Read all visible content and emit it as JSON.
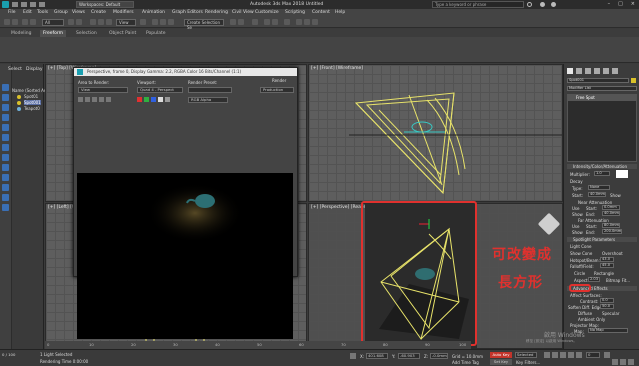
{
  "titlebar": {
    "workspace": "Workspaces: Default",
    "title": "Autodesk 3ds Max 2018    Untitled",
    "search_placeholder": "Type a keyword or phrase"
  },
  "menubar": {
    "items": [
      "File",
      "Edit",
      "Tools",
      "Group",
      "Views",
      "Create",
      "Modifiers",
      "Animation",
      "Graph Editors",
      "Rendering",
      "Civil View",
      "Customize",
      "Scripting",
      "Content",
      "Help"
    ]
  },
  "toolbar": {
    "filter": "All",
    "view": "View",
    "selection_set": "Create Selection Se"
  },
  "ribbon": {
    "tabs": [
      "Modeling",
      "Freeform",
      "Selection",
      "Object Paint",
      "Populate"
    ],
    "active": "Freeform"
  },
  "scene_explorer": {
    "tabs": [
      "Select",
      "Display"
    ],
    "header": "Name (Sorted Asc",
    "items": [
      "Spot01",
      "Spot001",
      "Teapot0"
    ],
    "selected": "Spot001"
  },
  "viewports": {
    "top_left": "[+] [Top] [Wireframe]",
    "top_right": "[+] [Front] [Wireframe]",
    "bottom_left": "[+] [Left] [Wireframe]",
    "bottom_right": "[+] [Perspective] [Realistic]"
  },
  "render_window": {
    "title": "Perspective, frame 0, Display Gamma: 2.2, RGBA Color 16 Bits/Channel (1:1)",
    "area_label": "Area to Render:",
    "area_value": "View",
    "viewport_label": "Viewport:",
    "viewport_value": "Quad 4 - Perspect",
    "preset_label": "Render Preset:",
    "preset_value": "",
    "render_label": "Render",
    "production_value": "Production",
    "channel_value": "RGB Alpha"
  },
  "command_panel": {
    "object_name": "Spot001",
    "modifier_list": "Modifier List",
    "stack_item": "Free Spot",
    "rollout_intensity": "Intensity/Color/Attenuation",
    "multiplier_label": "Multiplier:",
    "multiplier_value": "1.0",
    "decay_label": "Decay",
    "type_label": "Type:",
    "type_value": "None",
    "start_label": "Start:",
    "start_value": "40.0mm",
    "show_label": "Show",
    "near_atten": "Near Attenuation",
    "use_label": "Use",
    "start_short": "Start:",
    "near_start": "0.0mm",
    "end_label": "End:",
    "near_end": "40.0mm",
    "far_atten": "Far Attenuation",
    "far_start": "80.0mm",
    "far_end": "200.0mm",
    "rollout_spot": "Spotlight Parameters",
    "light_cone": "Light Cone",
    "show_cone": "Show Cone",
    "overshoot": "Overshoot",
    "hotspot_label": "Hotspot/Beam:",
    "hotspot_value": "43.0",
    "falloff_label": "Falloff/Field:",
    "falloff_value": "45.0",
    "circle": "Circle",
    "rectangle": "Rectangle",
    "aspect_label": "Aspect:",
    "aspect_value": "2.03",
    "bitmap_fit": "Bitmap Fit...",
    "rollout_adv": "Advanced Effects",
    "affect_surfaces": "Affect Surfaces:",
    "contrast_label": "Contrast:",
    "contrast_value": "0.0",
    "soften_label": "Soften Diff. Edge:",
    "soften_value": "50.0",
    "diffuse": "Diffuse",
    "specular": "Specular",
    "ambient": "Ambient Only",
    "projector": "Projector Map:",
    "map_label": "Map:",
    "map_value": "No Map"
  },
  "annotation": {
    "line1": "可改變成",
    "line2": "長方形",
    "color": "#e0312e"
  },
  "statusbar": {
    "light_selected": "1 Light Selected",
    "rendering_time": "Rendering Time 0:00:00",
    "frames": "0 / 100",
    "x_label": "X:",
    "x_value": "401.608",
    "y_label": "Y:",
    "y_value": "-60.903",
    "z_label": "Z:",
    "z_value": "-0.0mm",
    "grid": "Grid = 10.0mm",
    "add_time_tag": "Add Time Tag",
    "auto_key": "Auto Key",
    "selected": "Selected",
    "set_key": "Set Key",
    "key_filters": "Key Filters...",
    "frame_value": "0",
    "watermark_line1": "啟用 Windows",
    "watermark_line2": "移至 [設定] 以啟用 Windows。"
  },
  "timeline": {
    "ticks": [
      "0",
      "10",
      "20",
      "30",
      "40",
      "50",
      "60",
      "70",
      "80",
      "90",
      "100"
    ]
  }
}
